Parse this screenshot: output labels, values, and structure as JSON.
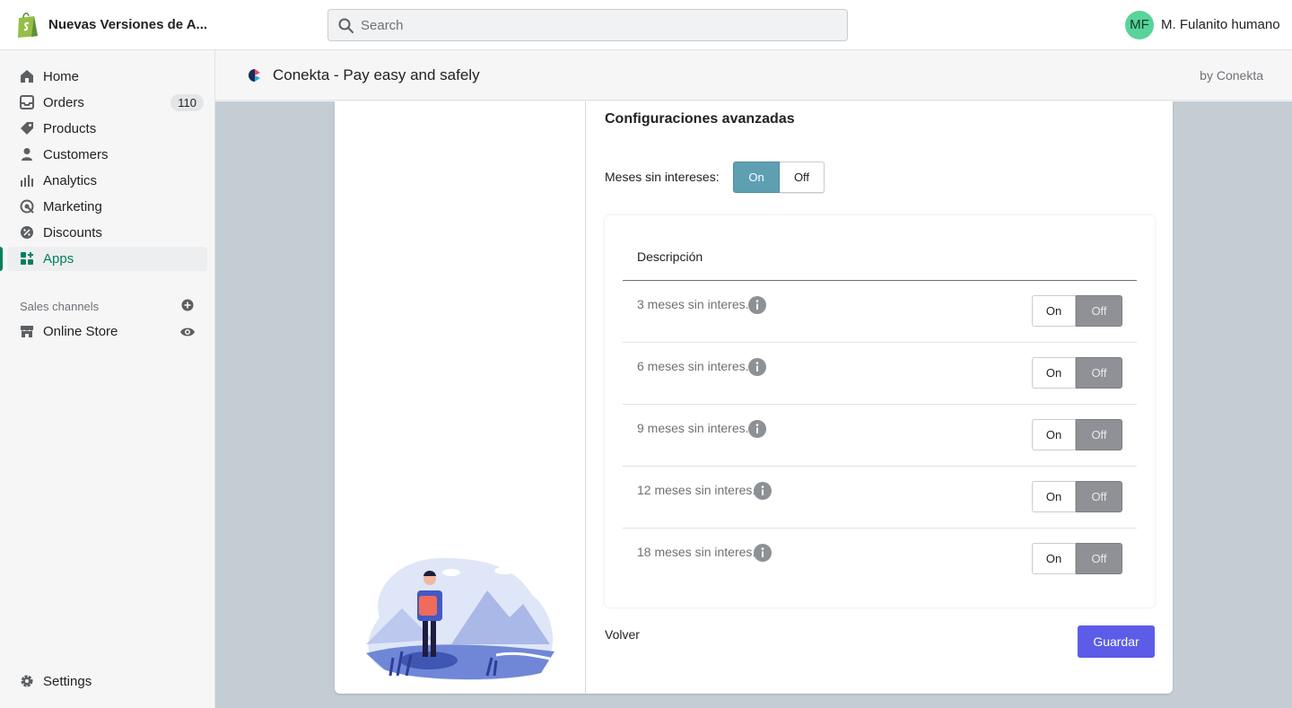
{
  "topbar": {
    "store_name": "Nuevas Versiones de A...",
    "search_placeholder": "Search",
    "avatar_initials": "MF",
    "user_name": "M. Fulanito humano"
  },
  "sidebar": {
    "items": [
      {
        "label": "Home",
        "icon": "home-icon"
      },
      {
        "label": "Orders",
        "icon": "orders-icon",
        "badge": "110"
      },
      {
        "label": "Products",
        "icon": "tag-icon"
      },
      {
        "label": "Customers",
        "icon": "person-icon"
      },
      {
        "label": "Analytics",
        "icon": "analytics-icon"
      },
      {
        "label": "Marketing",
        "icon": "marketing-icon"
      },
      {
        "label": "Discounts",
        "icon": "discount-icon"
      },
      {
        "label": "Apps",
        "icon": "apps-icon",
        "active": true
      }
    ],
    "sales_channels_title": "Sales channels",
    "online_store_label": "Online Store",
    "settings_label": "Settings"
  },
  "app_header": {
    "title": "Conekta - Pay easy and safely",
    "by": "by Conekta"
  },
  "config": {
    "title": "Configuraciones avanzadas",
    "meses_label": "Meses sin intereses:",
    "meses_value": "On",
    "on_label": "On",
    "off_label": "Off",
    "description_header": "Descripción",
    "rows": [
      {
        "label": "3 meses sin interes.",
        "value": "Off"
      },
      {
        "label": "6 meses sin interes.",
        "value": "Off"
      },
      {
        "label": "9 meses sin interes.",
        "value": "Off"
      },
      {
        "label": "12 meses sin interes.",
        "value": "Off"
      },
      {
        "label": "18 meses sin interes.",
        "value": "Off"
      }
    ],
    "back_label": "Volver",
    "save_label": "Guardar"
  },
  "colors": {
    "brand_green": "#008060",
    "toggle_on": "#5e9fb2",
    "toggle_off_selected": "#8f9196",
    "primary_button": "#5c5ce8"
  }
}
